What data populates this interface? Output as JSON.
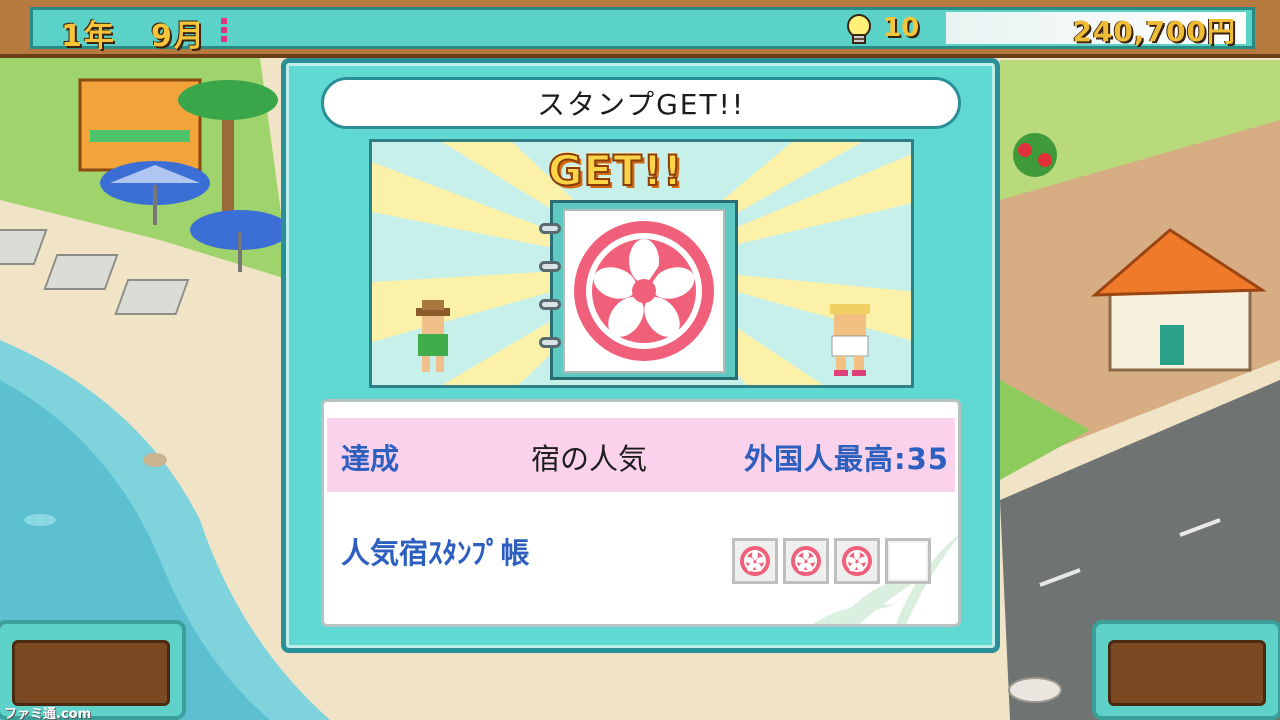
{
  "status_bar": {
    "year": "1年",
    "month": "9月",
    "idea_points": "10",
    "money": "240,700円"
  },
  "dialog": {
    "title": "スタンプGET!!",
    "banner": "GET!!",
    "achievement": {
      "label": "達成",
      "item": "宿の人気",
      "value": "外国人最高:35"
    },
    "stampbook": {
      "label": "人気宿ｽﾀﾝﾌﾟ帳",
      "filled": 3,
      "total": 4
    }
  },
  "watermark": "ファミ通.com",
  "colors": {
    "frame": "#60d9d2",
    "stamp_pink": "#f0607a",
    "label_blue": "#2d5fbf"
  },
  "icons": [
    "lightbulb-icon",
    "hibiscus-stamp-icon"
  ]
}
